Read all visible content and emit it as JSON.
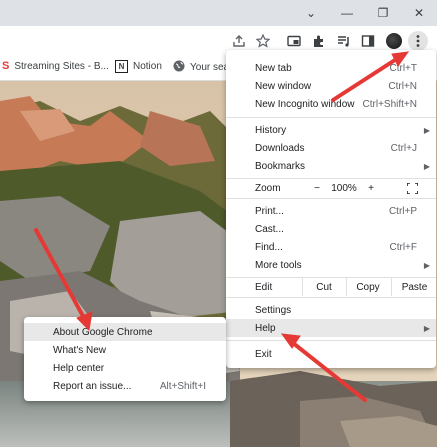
{
  "bookmarks": [
    {
      "label": "Streaming Sites - B...",
      "icon": "bookmark-s-icon"
    },
    {
      "label": "Notion",
      "icon": "notion-icon"
    },
    {
      "label": "Your sea",
      "icon": "globe-icon"
    }
  ],
  "menu": {
    "new_tab": {
      "label": "New tab",
      "shortcut": "Ctrl+T"
    },
    "new_window": {
      "label": "New window",
      "shortcut": "Ctrl+N"
    },
    "new_incognito": {
      "label": "New Incognito window",
      "shortcut": "Ctrl+Shift+N"
    },
    "history": {
      "label": "History"
    },
    "downloads": {
      "label": "Downloads",
      "shortcut": "Ctrl+J"
    },
    "bookmarks": {
      "label": "Bookmarks"
    },
    "zoom": {
      "label": "Zoom",
      "minus": "−",
      "value": "100%",
      "plus": "+"
    },
    "print": {
      "label": "Print...",
      "shortcut": "Ctrl+P"
    },
    "cast": {
      "label": "Cast..."
    },
    "find": {
      "label": "Find...",
      "shortcut": "Ctrl+F"
    },
    "more_tools": {
      "label": "More tools"
    },
    "edit": {
      "label": "Edit",
      "cut": "Cut",
      "copy": "Copy",
      "paste": "Paste"
    },
    "settings": {
      "label": "Settings"
    },
    "help": {
      "label": "Help"
    },
    "exit": {
      "label": "Exit"
    }
  },
  "help_submenu": {
    "about": {
      "label": "About Google Chrome"
    },
    "whats_new": {
      "label": "What's New"
    },
    "help_center": {
      "label": "Help center"
    },
    "report": {
      "label": "Report an issue...",
      "shortcut": "Alt+Shift+I"
    }
  },
  "colors": {
    "annotation_arrow": "#e53935",
    "highlight": "#e8e8e8"
  }
}
